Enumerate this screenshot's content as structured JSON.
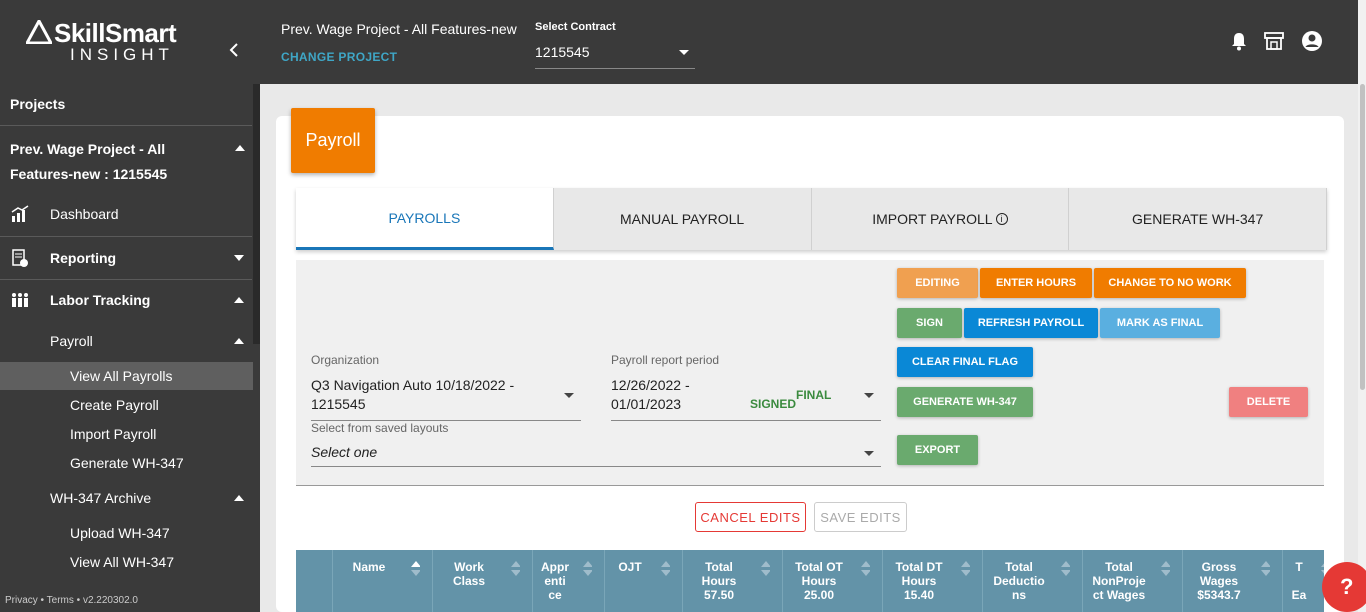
{
  "sidebar": {
    "logo_brand": "SkillSmart",
    "logo_sub": "INSIGHT",
    "heading": "Projects",
    "project": "Prev. Wage Project - All Features-new : 1215545",
    "items": {
      "dashboard": "Dashboard",
      "reporting": "Reporting",
      "labor_tracking": "Labor Tracking",
      "payroll": "Payroll",
      "view_all_payrolls": "View All Payrolls",
      "create_payroll": "Create Payroll",
      "import_payroll": "Import Payroll",
      "generate_wh347": "Generate WH-347",
      "wh347_archive": "WH-347 Archive",
      "upload_wh347": "Upload WH-347",
      "view_all_wh347": "View All WH-347"
    },
    "footer": "Privacy • Terms • v2.220302.0"
  },
  "topbar": {
    "project_title": "Prev. Wage Project - All Features-new",
    "change_project": "CHANGE PROJECT",
    "contract_label": "Select Contract",
    "contract_value": "1215545"
  },
  "main": {
    "section_tag": "Payroll",
    "tabs": [
      "PAYROLLS",
      "MANUAL PAYROLL",
      "IMPORT PAYROLL",
      "GENERATE WH-347"
    ],
    "organization_label": "Organization",
    "organization_value": "Q3 Navigation Auto 10/18/2022 - 1215545",
    "period_label": "Payroll report period",
    "period_value": "12/26/2022 - 01/01/2023",
    "period_status_signed": "SIGNED",
    "period_status_final": "FINAL",
    "layouts_label": "Select from saved layouts",
    "layouts_value": "Select one",
    "buttons": {
      "editing": "EDITING",
      "enter_hours": "ENTER HOURS",
      "change_no_work": "CHANGE TO NO WORK",
      "sign": "SIGN",
      "refresh": "REFRESH PAYROLL",
      "mark_final": "MARK AS FINAL",
      "clear_final": "CLEAR FINAL FLAG",
      "generate": "GENERATE WH-347",
      "delete": "DELETE",
      "export": "EXPORT",
      "cancel_edits": "CANCEL EDITS",
      "save_edits": "SAVE EDITS"
    },
    "colors": {
      "orange": "#f07c00",
      "editing": "#f0a050",
      "green": "#6aaa6e",
      "blue": "#0a88d6",
      "light_blue": "#5aafe0",
      "delete_red": "#f08080",
      "header_teal": "#6393a8"
    },
    "table_headers": [
      {
        "line1": "Name",
        "line2": "",
        "line3": ""
      },
      {
        "line1": "Work",
        "line2": "Class",
        "line3": ""
      },
      {
        "line1": "Appr",
        "line2": "enti",
        "line3": "ce"
      },
      {
        "line1": "OJT",
        "line2": "",
        "line3": ""
      },
      {
        "line1": "Total",
        "line2": "Hours",
        "line3": "57.50"
      },
      {
        "line1": "Total OT",
        "line2": "Hours",
        "line3": "25.00"
      },
      {
        "line1": "Total DT",
        "line2": "Hours",
        "line3": "15.40"
      },
      {
        "line1": "Total",
        "line2": "Deductio",
        "line3": "ns"
      },
      {
        "line1": "Total",
        "line2": "NonProje",
        "line3": "ct Wages"
      },
      {
        "line1": "Gross",
        "line2": "Wages",
        "line3": "$5343.7"
      },
      {
        "line1": "T",
        "line2": "",
        "line3": "Ea"
      }
    ]
  }
}
